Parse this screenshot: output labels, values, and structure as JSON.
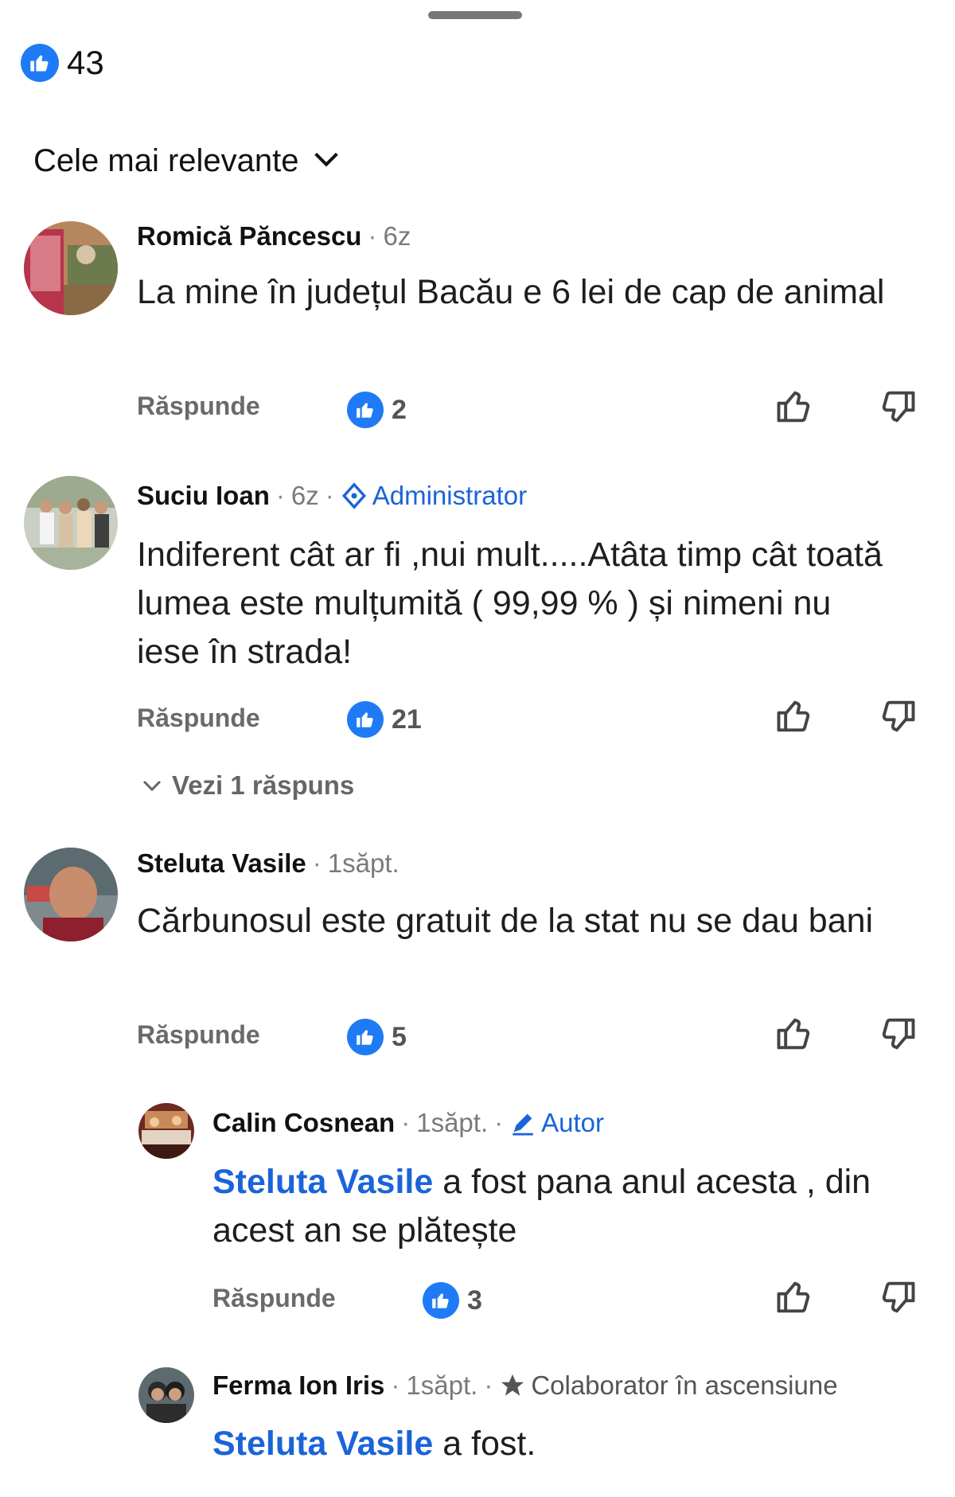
{
  "reactions": {
    "count": "43",
    "icon": "like-icon",
    "color": "#1f7bf5"
  },
  "sort": {
    "label": "Cele mai relevante",
    "icon": "chevron-down-icon"
  },
  "comments": [
    {
      "author": "Romică Păncescu",
      "time": "6z",
      "text": "La mine în județul Bacău e 6 lei de cap de animal",
      "reply_label": "Răspunde",
      "likes": "2"
    },
    {
      "author": "Suciu Ioan",
      "time": "6z",
      "badge": "Administrator",
      "text": "Indiferent cât ar fi ,nui mult.....Atâta timp cât toată lumea este mulțumită ( 99,99 % ) și nimeni nu iese în strada!",
      "reply_label": "Răspunde",
      "likes": "21",
      "see_replies": "Vezi 1 răspuns"
    },
    {
      "author": "Steluta Vasile",
      "time": "1săpt.",
      "text": "Cărbunosul este gratuit de la stat nu se dau bani",
      "reply_label": "Răspunde",
      "likes": "5"
    }
  ],
  "replies": [
    {
      "author": "Calin Cosnean",
      "time": "1săpt.",
      "badge": "Autor",
      "mention": "Steluta Vasile",
      "text": " a fost pana anul acesta , din acest an se plătește",
      "reply_label": "Răspunde",
      "likes": "3"
    },
    {
      "author": "Ferma Ion Iris",
      "time": "1săpt.",
      "badge": "Colaborator în ascensiune",
      "mention": "Steluta Vasile",
      "text": " a fost."
    }
  ]
}
